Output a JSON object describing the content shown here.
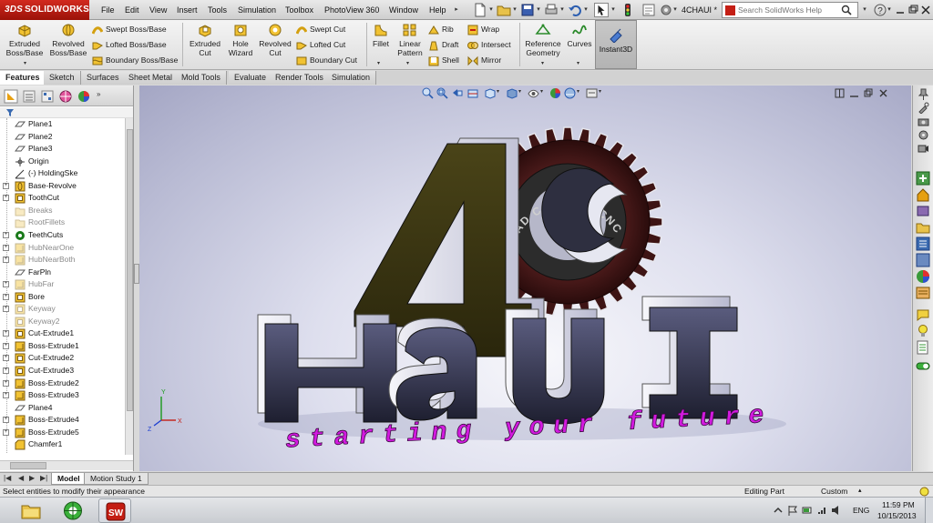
{
  "app": {
    "brand": "SOLIDWORKS",
    "brand_prefix": "3DS",
    "document_title": "4CHAUI *"
  },
  "menu": [
    "File",
    "Edit",
    "View",
    "Insert",
    "Tools",
    "Simulation",
    "Toolbox",
    "PhotoView 360",
    "Window",
    "Help"
  ],
  "search": {
    "placeholder": "Search SolidWorks Help"
  },
  "ribbon": {
    "extruded_boss": "Extruded\nBoss/Base",
    "revolved_boss": "Revolved\nBoss/Base",
    "swept_boss": "Swept Boss/Base",
    "lofted_boss": "Lofted Boss/Base",
    "boundary_boss": "Boundary Boss/Base",
    "extruded_cut": "Extruded\nCut",
    "hole_wizard": "Hole\nWizard",
    "revolved_cut": "Revolved\nCut",
    "swept_cut": "Swept Cut",
    "lofted_cut": "Lofted Cut",
    "boundary_cut": "Boundary Cut",
    "fillet": "Fillet",
    "linear_pattern": "Linear\nPattern",
    "rib": "Rib",
    "draft": "Draft",
    "shell": "Shell",
    "wrap": "Wrap",
    "intersect": "Intersect",
    "mirror": "Mirror",
    "reference_geometry": "Reference\nGeometry",
    "curves": "Curves",
    "instant3d": "Instant3D"
  },
  "tabs": [
    "Features",
    "Sketch",
    "Surfaces",
    "Sheet Metal",
    "Mold Tools",
    "Evaluate",
    "Render Tools",
    "Simulation"
  ],
  "active_tab": "Features",
  "feature_tree": [
    {
      "label": "Plane1",
      "icon": "plane-icon",
      "expandable": false,
      "suppressed": false
    },
    {
      "label": "Plane2",
      "icon": "plane-icon",
      "expandable": false,
      "suppressed": false
    },
    {
      "label": "Plane3",
      "icon": "plane-icon",
      "expandable": false,
      "suppressed": false
    },
    {
      "label": "Origin",
      "icon": "origin-icon",
      "expandable": false,
      "suppressed": false
    },
    {
      "label": "(-) HoldingSke",
      "icon": "sketch-icon",
      "expandable": false,
      "suppressed": false
    },
    {
      "label": "Base-Revolve",
      "icon": "revolve-icon",
      "expandable": true,
      "suppressed": false
    },
    {
      "label": "ToothCut",
      "icon": "cut-icon",
      "expandable": true,
      "suppressed": false
    },
    {
      "label": "Breaks",
      "icon": "folder-icon",
      "expandable": false,
      "suppressed": true
    },
    {
      "label": "RootFillets",
      "icon": "folder-icon",
      "expandable": false,
      "suppressed": true
    },
    {
      "label": "TeethCuts",
      "icon": "pattern-icon",
      "expandable": true,
      "suppressed": false
    },
    {
      "label": "HubNearOne",
      "icon": "extrude-icon",
      "expandable": true,
      "suppressed": true
    },
    {
      "label": "HubNearBoth",
      "icon": "extrude-icon",
      "expandable": true,
      "suppressed": true
    },
    {
      "label": "FarPln",
      "icon": "plane-icon",
      "expandable": false,
      "suppressed": false
    },
    {
      "label": "HubFar",
      "icon": "extrude-icon",
      "expandable": true,
      "suppressed": true
    },
    {
      "label": "Bore",
      "icon": "cut-icon",
      "expandable": true,
      "suppressed": false
    },
    {
      "label": "Keyway",
      "icon": "cut-icon",
      "expandable": true,
      "suppressed": true
    },
    {
      "label": "Keyway2",
      "icon": "cut-icon",
      "expandable": false,
      "suppressed": true
    },
    {
      "label": "Cut-Extrude1",
      "icon": "cut-icon",
      "expandable": true,
      "suppressed": false
    },
    {
      "label": "Boss-Extrude1",
      "icon": "extrude-icon",
      "expandable": true,
      "suppressed": false
    },
    {
      "label": "Cut-Extrude2",
      "icon": "cut-icon",
      "expandable": true,
      "suppressed": false
    },
    {
      "label": "Cut-Extrude3",
      "icon": "cut-icon",
      "expandable": true,
      "suppressed": false
    },
    {
      "label": "Boss-Extrude2",
      "icon": "extrude-icon",
      "expandable": true,
      "suppressed": false
    },
    {
      "label": "Boss-Extrude3",
      "icon": "extrude-icon",
      "expandable": true,
      "suppressed": false
    },
    {
      "label": "Plane4",
      "icon": "plane-icon",
      "expandable": false,
      "suppressed": false
    },
    {
      "label": "Boss-Extrude4",
      "icon": "extrude-icon",
      "expandable": true,
      "suppressed": false
    },
    {
      "label": "Boss-Extrude5",
      "icon": "extrude-icon",
      "expandable": true,
      "suppressed": false
    },
    {
      "label": "Chamfer1",
      "icon": "chamfer-icon",
      "expandable": false,
      "suppressed": false
    }
  ],
  "bottom_tabs": [
    "Model",
    "Motion Study 1"
  ],
  "active_bottom_tab": "Model",
  "status": {
    "message": "Select entities to modify their appearance",
    "mode": "Editing Part",
    "units": "Custom"
  },
  "model_text": {
    "main": "4C",
    "gear_ring": "CAD CAM CAE CNC",
    "word": "HaUI",
    "slogan": "starting your future"
  },
  "taskbar": {
    "language": "ENG",
    "time": "11:59 PM",
    "date": "10/15/2013"
  },
  "colors": {
    "brand_red": "#c41e14",
    "viewport_bg": "#c9cade",
    "letter_face": "#2d2e44",
    "letter_side": "#e4e4ef",
    "four_face": "#3a3514",
    "gear_body": "#3a1515",
    "slogan": "#d21adf"
  }
}
